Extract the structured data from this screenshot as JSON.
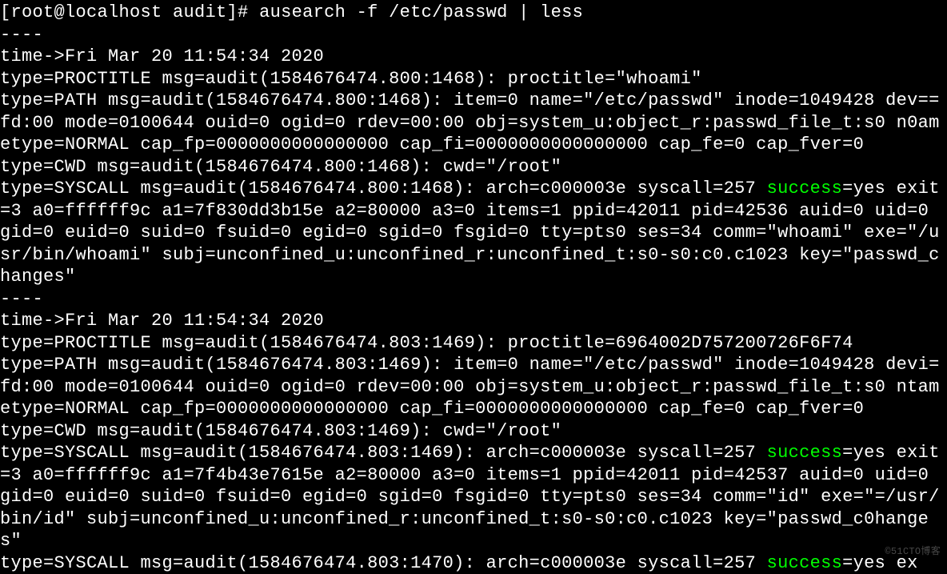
{
  "terminal": {
    "prompt": "[root@localhost audit]# ",
    "command": "ausearch -f /etc/passwd | less",
    "separator1": "----",
    "block1": {
      "time": "time->Fri Mar 20 11:54:34 2020",
      "proctitle": "type=PROCTITLE msg=audit(1584676474.800:1468): proctitle=\"whoami\"",
      "path": "type=PATH msg=audit(1584676474.800:1468): item=0 name=\"/etc/passwd\" inode=1049428 dev==fd:00 mode=0100644 ouid=0 ogid=0 rdev=00:00 obj=system_u:object_r:passwd_file_t:s0 n0ametype=NORMAL cap_fp=0000000000000000 cap_fi=0000000000000000 cap_fe=0 cap_fver=0",
      "cwd": "type=CWD msg=audit(1584676474.800:1468): cwd=\"/root\"",
      "syscall_pre": "type=SYSCALL msg=audit(1584676474.800:1468): arch=c000003e syscall=257 ",
      "syscall_success": "success",
      "syscall_post": "=yes exit=3 a0=ffffff9c a1=7f830dd3b15e a2=80000 a3=0 items=1 ppid=42011 pid=42536 auid=0 uid=0 gid=0 euid=0 suid=0 fsuid=0 egid=0 sgid=0 fsgid=0 tty=pts0 ses=34 comm=\"whoami\" exe=\"/usr/bin/whoami\" subj=unconfined_u:unconfined_r:unconfined_t:s0-s0:c0.c1023 key=\"passwd_changes\""
    },
    "separator2": "----",
    "block2": {
      "time": "time->Fri Mar 20 11:54:34 2020",
      "proctitle": "type=PROCTITLE msg=audit(1584676474.803:1469): proctitle=6964002D757200726F6F74",
      "path": "type=PATH msg=audit(1584676474.803:1469): item=0 name=\"/etc/passwd\" inode=1049428 devi=fd:00 mode=0100644 ouid=0 ogid=0 rdev=00:00 obj=system_u:object_r:passwd_file_t:s0 ntametype=NORMAL cap_fp=0000000000000000 cap_fi=0000000000000000 cap_fe=0 cap_fver=0",
      "cwd": "type=CWD msg=audit(1584676474.803:1469): cwd=\"/root\"",
      "syscall_pre": "type=SYSCALL msg=audit(1584676474.803:1469): arch=c000003e syscall=257 ",
      "syscall_success": "success",
      "syscall_post": "=yes exit=3 a0=ffffff9c a1=7f4b43e7615e a2=80000 a3=0 items=1 ppid=42011 pid=42537 auid=0 uid=0 gid=0 euid=0 suid=0 fsuid=0 egid=0 sgid=0 fsgid=0 tty=pts0 ses=34 comm=\"id\" exe=\"=/usr/bin/id\" subj=unconfined_u:unconfined_r:unconfined_t:s0-s0:c0.c1023 key=\"passwd_c0hanges\""
    },
    "block3": {
      "syscall_pre": "type=SYSCALL msg=audit(1584676474.803:1470): arch=c000003e syscall=257 ",
      "syscall_success": "success",
      "syscall_post": "=yes ex"
    }
  },
  "watermark": "©51CTO博客"
}
